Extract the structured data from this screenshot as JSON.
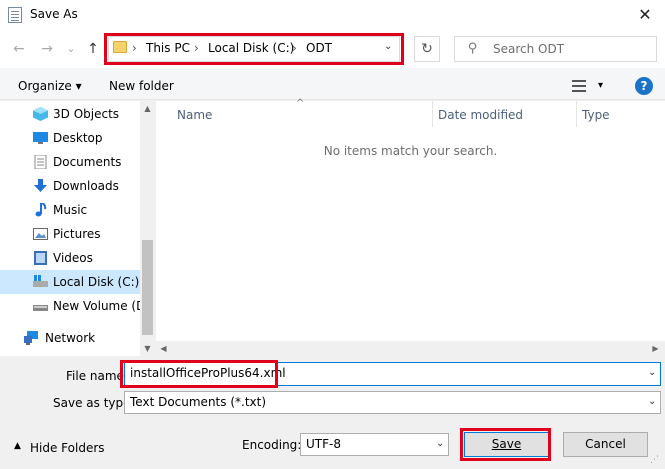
{
  "window": {
    "title": "Save As",
    "close": "✕"
  },
  "nav": {
    "back": "←",
    "forward": "→",
    "recent": "⌄",
    "up": "↑",
    "breadcrumbs": [
      "This PC",
      "Local Disk (C:)",
      "ODT"
    ],
    "sep": "›",
    "dropdown": "⌄",
    "refresh": "↻",
    "search_placeholder": "Search ODT",
    "search_icon": "⚲"
  },
  "toolbar": {
    "organize": "Organize ▾",
    "new_folder": "New folder",
    "view_dd": "▾",
    "help": "?"
  },
  "sidebar": {
    "items": [
      {
        "label": "3D Objects",
        "icon": "cube-icon"
      },
      {
        "label": "Desktop",
        "icon": "desktop-icon"
      },
      {
        "label": "Documents",
        "icon": "documents-icon"
      },
      {
        "label": "Downloads",
        "icon": "download-icon"
      },
      {
        "label": "Music",
        "icon": "music-icon"
      },
      {
        "label": "Pictures",
        "icon": "pictures-icon"
      },
      {
        "label": "Videos",
        "icon": "videos-icon"
      },
      {
        "label": "Local Disk (C:)",
        "icon": "drive-icon",
        "selected": true
      },
      {
        "label": "New Volume (D:",
        "icon": "drive-icon"
      },
      {
        "label": "Network",
        "icon": "network-icon"
      }
    ]
  },
  "list": {
    "columns": [
      "Name",
      "Date modified",
      "Type"
    ],
    "sort_indicator": "^",
    "empty_message": "No items match your search."
  },
  "form": {
    "file_name_label": "File name:",
    "file_name_value": "installOfficeProPlus64.xml",
    "save_as_type_label": "Save as type:",
    "save_as_type_value": "Text Documents (*.txt)",
    "encoding_label": "Encoding:",
    "encoding_value": "UTF-8",
    "dd": "⌄"
  },
  "buttons": {
    "save": "Save",
    "cancel": "Cancel",
    "hide_folders": "Hide Folders",
    "hide_chevron": "▲"
  },
  "colors": {
    "highlight": "#e0001b",
    "accent": "#0078d7",
    "selected": "#cce8ff"
  }
}
